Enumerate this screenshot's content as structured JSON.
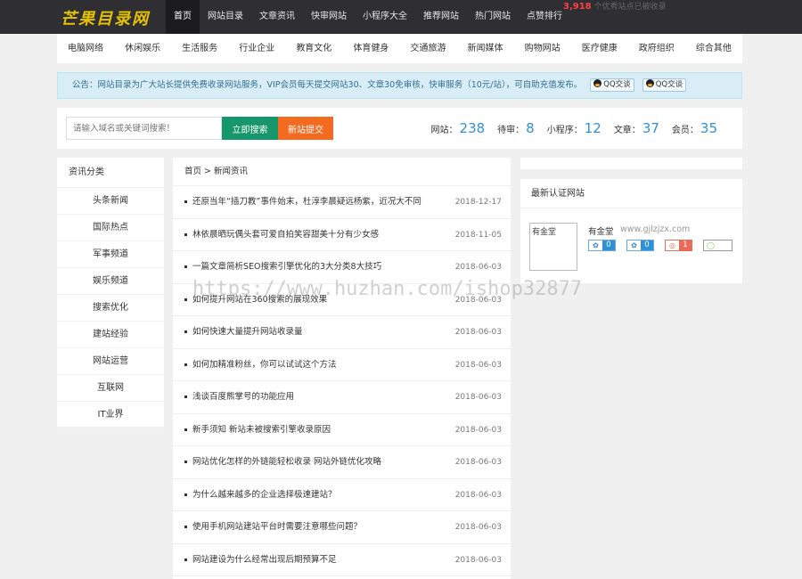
{
  "logo": "芒果目录网",
  "main_nav": [
    "首页",
    "网站目录",
    "文章资讯",
    "快审网站",
    "小程序大全",
    "推荐网站",
    "热门网站",
    "点赞排行"
  ],
  "ticker": {
    "number": "3,918",
    "text": "个优秀站点已被收录"
  },
  "categories": [
    "电脑网络",
    "休闲娱乐",
    "生活服务",
    "行业企业",
    "教育文化",
    "体育健身",
    "交通旅游",
    "新闻媒体",
    "购物网站",
    "医疗健康",
    "政府组织",
    "综合其他"
  ],
  "notice": {
    "text": "公告：网站目录为广大站长提供免费收录网站服务，VIP会员每天提交网站30、文章30免审核，快审服务（10元/站），可自助充值发布。",
    "qq1": "QQ交谈",
    "qq2": "QQ交谈"
  },
  "search": {
    "placeholder": "请输入域名或关键词搜索！",
    "search_btn": "立即搜索",
    "submit_btn": "新站提交"
  },
  "counts": {
    "sites_label": "网站：",
    "sites": "238",
    "pending_label": "待审：",
    "pending": "8",
    "mini_label": "小程序：",
    "mini": "12",
    "articles_label": "文章：",
    "articles": "37",
    "members_label": "会员：",
    "members": "35"
  },
  "sidebar": {
    "title": "资讯分类",
    "items": [
      "头条新闻",
      "国际热点",
      "军事频道",
      "娱乐频道",
      "搜索优化",
      "建站经验",
      "网站运营",
      "互联网",
      "IT业界"
    ]
  },
  "breadcrumb": "首页 > 新闻资讯",
  "articles": [
    {
      "title": "还原当年“插刀教”事件始末，杜淳李晨疑远杨紫，近况大不同",
      "date": "2018-12-17"
    },
    {
      "title": "林依晨晒玩偶头套可爱自拍笑容甜美十分有少女感",
      "date": "2018-11-05"
    },
    {
      "title": "一篇文章简析SEO搜索引擎优化的3大分类8大技巧",
      "date": "2018-06-03"
    },
    {
      "title": "如何提升网站在360搜索的展现效果",
      "date": "2018-06-03"
    },
    {
      "title": "如何快速大量提升网站收录量",
      "date": "2018-06-03"
    },
    {
      "title": "如何加精准粉丝，你可以试试这个方法",
      "date": "2018-06-03"
    },
    {
      "title": "浅谈百度熊掌号的功能应用",
      "date": "2018-06-03"
    },
    {
      "title": "新手须知 新站未被搜索引擎收录原因",
      "date": "2018-06-03"
    },
    {
      "title": "网站优化怎样的外链能轻松收录 网站外链优化攻略",
      "date": "2018-06-03"
    },
    {
      "title": "为什么越来越多的企业选择极速建站？",
      "date": "2018-06-03"
    },
    {
      "title": "使用手机网站建站平台时需要注意哪些问题？",
      "date": "2018-06-03"
    },
    {
      "title": "网站建设为什么经常出现后期预算不足",
      "date": "2018-06-03"
    }
  ],
  "verified": {
    "title": "最新认证网站",
    "thumb_alt": "有金堂",
    "site_name": "有金堂",
    "site_url": "www.gjlzjzx.com",
    "badges": [
      "0",
      "0",
      "1",
      ""
    ]
  },
  "watermark": "https://www.huzhan.com/ishop32877",
  "colors": {
    "topbar": "#2f2f33",
    "search_btn": "#16976b",
    "submit_btn": "#f36b21",
    "count_value": "#2f90d8",
    "logo": "#e6c200"
  }
}
